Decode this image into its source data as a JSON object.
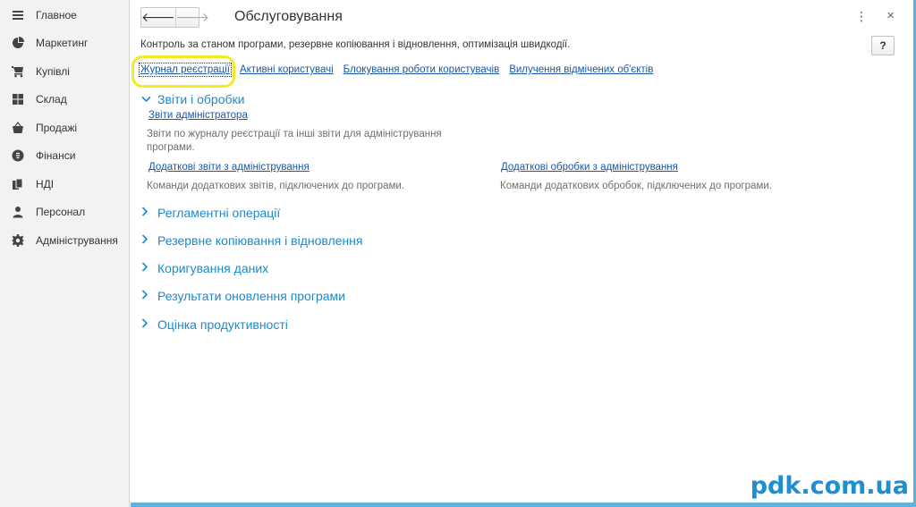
{
  "sidebar": {
    "items": [
      {
        "label": "Главное",
        "icon": "menu-icon"
      },
      {
        "label": "Маркетинг",
        "icon": "pie-chart-icon"
      },
      {
        "label": "Купівлі",
        "icon": "cart-icon"
      },
      {
        "label": "Склад",
        "icon": "grid-icon"
      },
      {
        "label": "Продажі",
        "icon": "basket-icon"
      },
      {
        "label": "Фінанси",
        "icon": "coin-icon"
      },
      {
        "label": "НДІ",
        "icon": "documents-icon"
      },
      {
        "label": "Персонал",
        "icon": "person-icon"
      },
      {
        "label": "Адміністрування",
        "icon": "gear-icon"
      }
    ]
  },
  "header": {
    "title": "Обслуговування",
    "menu": "⋮",
    "close": "×"
  },
  "description": "Контроль за станом програми, резервне копіювання і відновлення, оптимізація швидкодії.",
  "help": "?",
  "links": [
    "Журнал реєстрації",
    "Активні користувачі",
    "Блокування роботи користувачів",
    "Вилучення відмічених об'єктів"
  ],
  "reports_section": {
    "title": "Звіти і обробки",
    "admin_reports_link": "Звіти адміністратора",
    "admin_reports_desc": "Звіти по журналу реєстрації та інші звіти для адміністрування програми.",
    "extra_reports_link": "Додаткові звіти з адміністрування",
    "extra_reports_desc": "Команди додаткових звітів, підключених до програми.",
    "extra_processing_link": "Додаткові обробки з адміністрування",
    "extra_processing_desc": "Команди додаткових обробок, підключених до програми."
  },
  "sections": [
    "Регламентні операції",
    "Резервне копіювання і відновлення",
    "Коригування даних",
    "Результати оновлення програми",
    "Оцінка продуктивності"
  ],
  "watermark": "pdk.com.ua",
  "colors": {
    "link": "#1a57a7",
    "section": "#1a8ad0",
    "highlight": "#f5ea28"
  }
}
